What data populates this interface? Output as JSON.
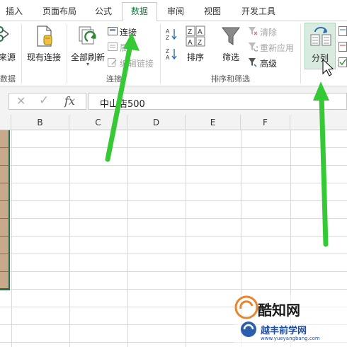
{
  "tabs": [
    {
      "label": "插入"
    },
    {
      "label": "页面布局"
    },
    {
      "label": "公式"
    },
    {
      "label": "数据",
      "active": true
    },
    {
      "label": "审阅"
    },
    {
      "label": "视图"
    },
    {
      "label": "开发工具"
    }
  ],
  "ribbon": {
    "external": {
      "btn_label": "来源",
      "group_label": "数据"
    },
    "existing_conn": {
      "label": "现有连接"
    },
    "refresh_all": {
      "label": "全部刷新"
    },
    "connections": {
      "label": "连接",
      "properties_label": "属",
      "edit_links_label": "编辑链接",
      "group_label": "连接"
    },
    "sort": {
      "label": "排序"
    },
    "filter": {
      "label": "筛选"
    },
    "clear": {
      "label": "清除"
    },
    "reapply": {
      "label": "重新应用"
    },
    "advanced": {
      "label": "高级"
    },
    "sort_filter_group_label": "排序和筛选",
    "text_to_columns": {
      "label": "分列"
    }
  },
  "formula_bar": {
    "cancel_glyph": "✕",
    "enter_glyph": "✓",
    "fx_glyph": "fx",
    "value": "中山店500"
  },
  "columns": [
    "B",
    "C",
    "D",
    "E",
    "F"
  ],
  "watermark": {
    "brand": "酷知网",
    "site_cn": "越丰前学网",
    "site_url": "www.yueyangbang.com"
  },
  "colors": {
    "accent_green": "#217346",
    "arrow_green": "#33cc33",
    "cell_fill": "#c8a98c",
    "active_button_bg": "#d9ebdf"
  }
}
